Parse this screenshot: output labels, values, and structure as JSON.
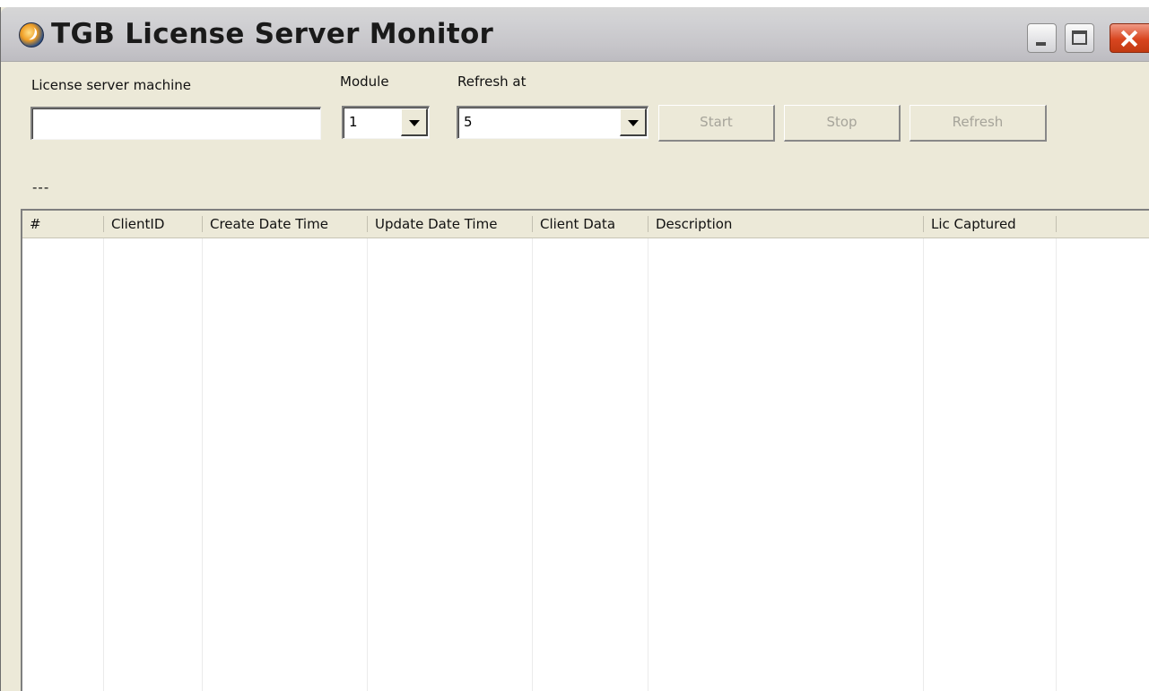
{
  "window": {
    "title": "TGB License Server Monitor",
    "controls": {
      "minimize": "minimize-icon",
      "maximize": "maximize-icon",
      "close": "close-icon"
    }
  },
  "toolbar": {
    "server_label": "License server machine",
    "server_value": "",
    "module_label": "Module",
    "module_value": "1",
    "refresh_label": "Refresh at",
    "refresh_value": "5",
    "start_label": "Start",
    "stop_label": "Stop",
    "refresh_button_label": "Refresh",
    "buttons_enabled": false
  },
  "status_text": "---",
  "table": {
    "columns": [
      "#",
      "ClientID",
      "Create Date Time",
      "Update Date Time",
      "Client Data",
      "Description",
      "Lic Captured",
      ""
    ],
    "rows": []
  }
}
